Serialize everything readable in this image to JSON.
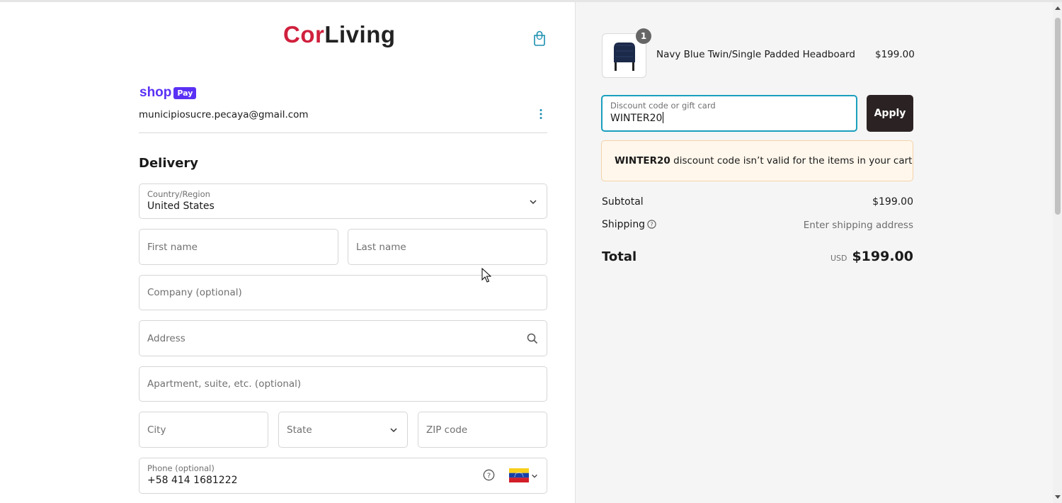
{
  "brand": {
    "logo_part1": "Cor",
    "logo_part2": "Living",
    "accent": "#d0203d"
  },
  "shop_pay": {
    "shop_text": "shop",
    "pay_text": "Pay",
    "email": "municipiosucre.pecaya@gmail.com"
  },
  "delivery": {
    "heading": "Delivery",
    "country": {
      "label": "Country/Region",
      "value": "United States"
    },
    "first_name_placeholder": "First name",
    "last_name_placeholder": "Last name",
    "company_placeholder": "Company (optional)",
    "address_placeholder": "Address",
    "apartment_placeholder": "Apartment, suite, etc. (optional)",
    "city_placeholder": "City",
    "state_placeholder": "State",
    "zip_placeholder": "ZIP code",
    "phone": {
      "label": "Phone (optional)",
      "value": "+58 414 1681222"
    }
  },
  "summary": {
    "item": {
      "name": "Navy Blue Twin/Single Padded Headboard",
      "price": "$199.00",
      "quantity": "1"
    },
    "discount": {
      "label": "Discount code or gift card",
      "value": "WINTER20",
      "apply_label": "Apply"
    },
    "alert": {
      "code": "WINTER20",
      "message": " discount code isn’t valid for the items in your cart"
    },
    "subtotal_label": "Subtotal",
    "subtotal_value": "$199.00",
    "shipping_label": "Shipping",
    "shipping_value": "Enter shipping address",
    "total_label": "Total",
    "total_currency": "USD",
    "total_value": "$199.00"
  }
}
